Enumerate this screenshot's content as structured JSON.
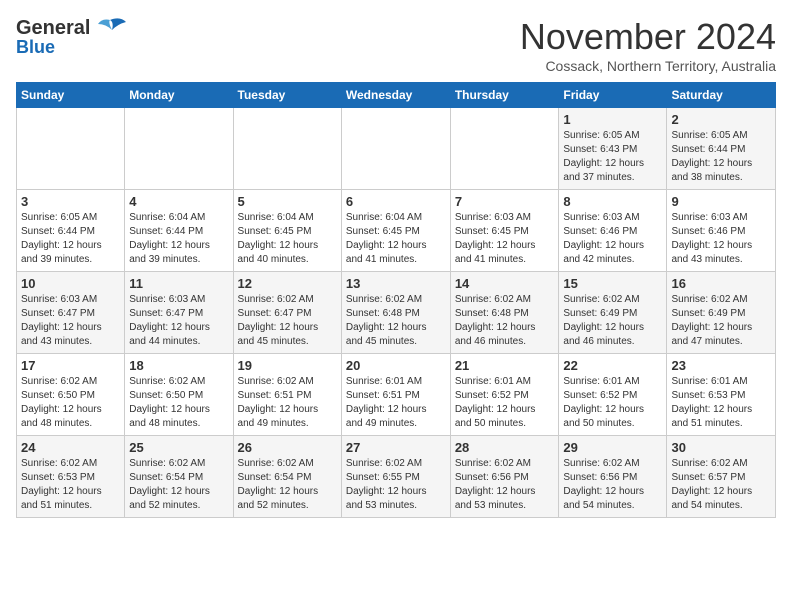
{
  "header": {
    "logo_line1": "General",
    "logo_line2": "Blue",
    "month": "November 2024",
    "location": "Cossack, Northern Territory, Australia"
  },
  "days_of_week": [
    "Sunday",
    "Monday",
    "Tuesday",
    "Wednesday",
    "Thursday",
    "Friday",
    "Saturday"
  ],
  "weeks": [
    [
      {
        "day": "",
        "info": ""
      },
      {
        "day": "",
        "info": ""
      },
      {
        "day": "",
        "info": ""
      },
      {
        "day": "",
        "info": ""
      },
      {
        "day": "",
        "info": ""
      },
      {
        "day": "1",
        "info": "Sunrise: 6:05 AM\nSunset: 6:43 PM\nDaylight: 12 hours and 37 minutes."
      },
      {
        "day": "2",
        "info": "Sunrise: 6:05 AM\nSunset: 6:44 PM\nDaylight: 12 hours and 38 minutes."
      }
    ],
    [
      {
        "day": "3",
        "info": "Sunrise: 6:05 AM\nSunset: 6:44 PM\nDaylight: 12 hours and 39 minutes."
      },
      {
        "day": "4",
        "info": "Sunrise: 6:04 AM\nSunset: 6:44 PM\nDaylight: 12 hours and 39 minutes."
      },
      {
        "day": "5",
        "info": "Sunrise: 6:04 AM\nSunset: 6:45 PM\nDaylight: 12 hours and 40 minutes."
      },
      {
        "day": "6",
        "info": "Sunrise: 6:04 AM\nSunset: 6:45 PM\nDaylight: 12 hours and 41 minutes."
      },
      {
        "day": "7",
        "info": "Sunrise: 6:03 AM\nSunset: 6:45 PM\nDaylight: 12 hours and 41 minutes."
      },
      {
        "day": "8",
        "info": "Sunrise: 6:03 AM\nSunset: 6:46 PM\nDaylight: 12 hours and 42 minutes."
      },
      {
        "day": "9",
        "info": "Sunrise: 6:03 AM\nSunset: 6:46 PM\nDaylight: 12 hours and 43 minutes."
      }
    ],
    [
      {
        "day": "10",
        "info": "Sunrise: 6:03 AM\nSunset: 6:47 PM\nDaylight: 12 hours and 43 minutes."
      },
      {
        "day": "11",
        "info": "Sunrise: 6:03 AM\nSunset: 6:47 PM\nDaylight: 12 hours and 44 minutes."
      },
      {
        "day": "12",
        "info": "Sunrise: 6:02 AM\nSunset: 6:47 PM\nDaylight: 12 hours and 45 minutes."
      },
      {
        "day": "13",
        "info": "Sunrise: 6:02 AM\nSunset: 6:48 PM\nDaylight: 12 hours and 45 minutes."
      },
      {
        "day": "14",
        "info": "Sunrise: 6:02 AM\nSunset: 6:48 PM\nDaylight: 12 hours and 46 minutes."
      },
      {
        "day": "15",
        "info": "Sunrise: 6:02 AM\nSunset: 6:49 PM\nDaylight: 12 hours and 46 minutes."
      },
      {
        "day": "16",
        "info": "Sunrise: 6:02 AM\nSunset: 6:49 PM\nDaylight: 12 hours and 47 minutes."
      }
    ],
    [
      {
        "day": "17",
        "info": "Sunrise: 6:02 AM\nSunset: 6:50 PM\nDaylight: 12 hours and 48 minutes."
      },
      {
        "day": "18",
        "info": "Sunrise: 6:02 AM\nSunset: 6:50 PM\nDaylight: 12 hours and 48 minutes."
      },
      {
        "day": "19",
        "info": "Sunrise: 6:02 AM\nSunset: 6:51 PM\nDaylight: 12 hours and 49 minutes."
      },
      {
        "day": "20",
        "info": "Sunrise: 6:01 AM\nSunset: 6:51 PM\nDaylight: 12 hours and 49 minutes."
      },
      {
        "day": "21",
        "info": "Sunrise: 6:01 AM\nSunset: 6:52 PM\nDaylight: 12 hours and 50 minutes."
      },
      {
        "day": "22",
        "info": "Sunrise: 6:01 AM\nSunset: 6:52 PM\nDaylight: 12 hours and 50 minutes."
      },
      {
        "day": "23",
        "info": "Sunrise: 6:01 AM\nSunset: 6:53 PM\nDaylight: 12 hours and 51 minutes."
      }
    ],
    [
      {
        "day": "24",
        "info": "Sunrise: 6:02 AM\nSunset: 6:53 PM\nDaylight: 12 hours and 51 minutes."
      },
      {
        "day": "25",
        "info": "Sunrise: 6:02 AM\nSunset: 6:54 PM\nDaylight: 12 hours and 52 minutes."
      },
      {
        "day": "26",
        "info": "Sunrise: 6:02 AM\nSunset: 6:54 PM\nDaylight: 12 hours and 52 minutes."
      },
      {
        "day": "27",
        "info": "Sunrise: 6:02 AM\nSunset: 6:55 PM\nDaylight: 12 hours and 53 minutes."
      },
      {
        "day": "28",
        "info": "Sunrise: 6:02 AM\nSunset: 6:56 PM\nDaylight: 12 hours and 53 minutes."
      },
      {
        "day": "29",
        "info": "Sunrise: 6:02 AM\nSunset: 6:56 PM\nDaylight: 12 hours and 54 minutes."
      },
      {
        "day": "30",
        "info": "Sunrise: 6:02 AM\nSunset: 6:57 PM\nDaylight: 12 hours and 54 minutes."
      }
    ]
  ]
}
